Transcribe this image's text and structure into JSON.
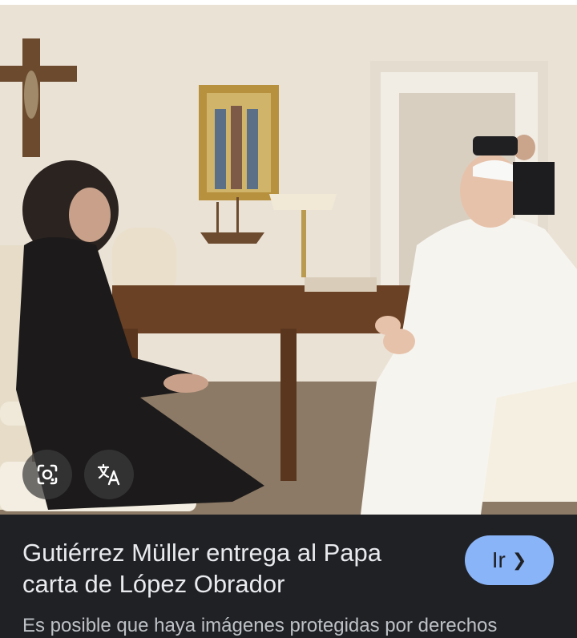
{
  "image": {
    "alt": "Beatriz Gutiérrez Müller con el Papa Francisco en el Vaticano"
  },
  "overlay_buttons": {
    "lens_icon": "camera-lens-icon",
    "translate_icon": "translate-icon"
  },
  "caption": {
    "title": "Gutiérrez Müller entrega al Papa carta de López Obrador",
    "go_label": "Ir",
    "snippet": "Es posible que haya imágenes protegidas por derechos"
  },
  "colors": {
    "background": "#202124",
    "title_text": "#e8eaed",
    "button_bg": "#8ab4f8",
    "button_text": "#202124"
  }
}
